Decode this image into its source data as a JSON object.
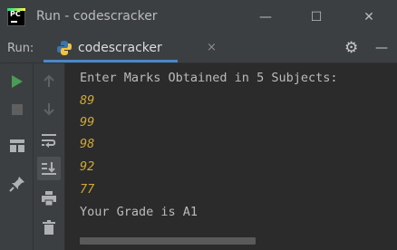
{
  "window": {
    "title": "Run - codescracker",
    "app_icon_text": "PC",
    "controls": {
      "minimize": "—",
      "maximize": "☐",
      "close": "✕"
    }
  },
  "run_panel": {
    "label": "Run:",
    "tab_label": "codescracker",
    "tab_close": "×",
    "settings_icon": "⚙",
    "hide_icon": "—"
  },
  "console": {
    "prompt": "Enter Marks Obtained in 5 Subjects:",
    "inputs": [
      "89",
      "99",
      "98",
      "92",
      "77"
    ],
    "result": "Your Grade is A1"
  },
  "colors": {
    "accent": "#4a88c7",
    "run_green": "#499c54",
    "input_text": "#cfa936"
  }
}
